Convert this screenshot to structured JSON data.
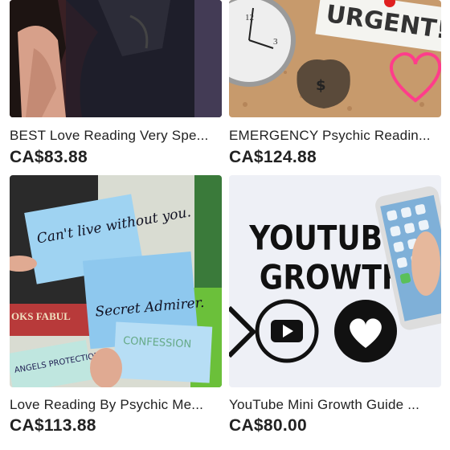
{
  "listings": [
    {
      "title": "BEST Love Reading Very Spe...",
      "price": "CA$83.88",
      "image_icon": "couple-photo-image"
    },
    {
      "title": "EMERGENCY Psychic Readin...",
      "price": "CA$124.88",
      "image_icon": "urgent-clock-image",
      "image_text": {
        "note": "URGENT!",
        "money_bag": "$"
      }
    },
    {
      "title": "Love Reading By Psychic Me...",
      "price": "CA$113.88",
      "image_icon": "sticky-notes-image",
      "image_text": {
        "note1": "Can't live without you.",
        "note2": "Secret Admirer.",
        "note3": "CONFESSION",
        "book": "OKS FABUL",
        "card": "ANGELS PROTECTION"
      }
    },
    {
      "title": "YouTube Mini Growth Guide ...",
      "price": "CA$80.00",
      "image_icon": "youtube-growth-image",
      "image_text": {
        "line1": "YOUTUBE",
        "line2": "GROWTH"
      }
    }
  ],
  "colors": {
    "text": "#222222",
    "background": "#ffffff",
    "heart_pink": "#ff3d8b",
    "note_blue": "#9fd3f2"
  }
}
